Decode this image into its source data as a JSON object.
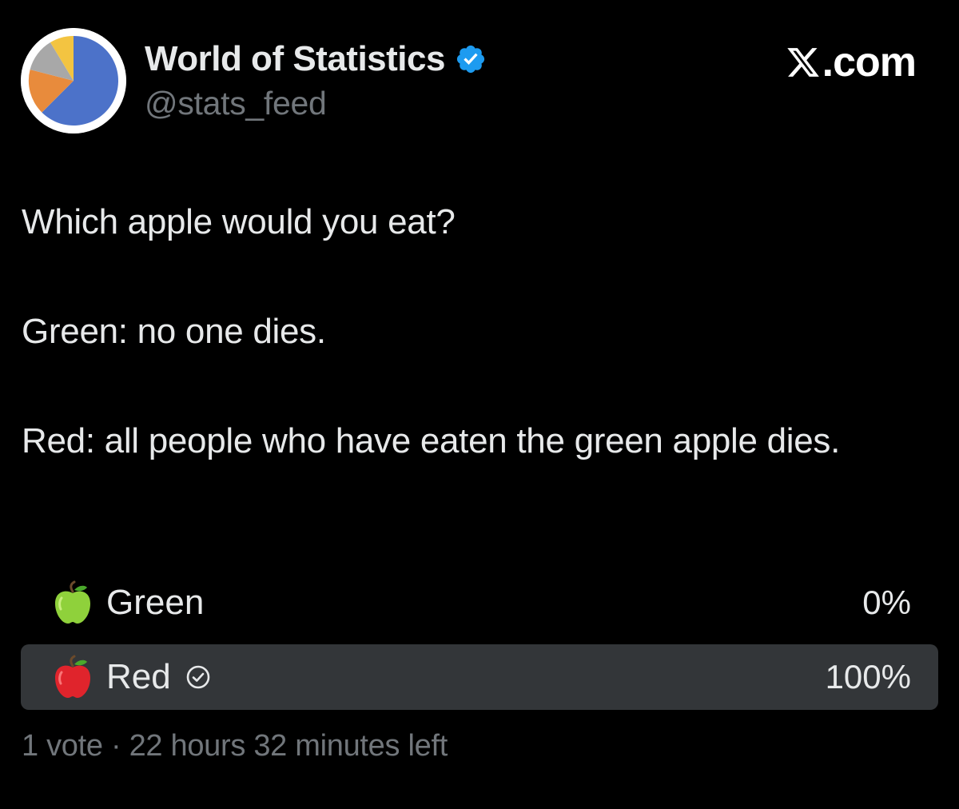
{
  "author": {
    "display_name": "World of Statistics",
    "handle": "@stats_feed",
    "avatar_icon": "pie-chart-avatar",
    "verified_icon": "verified-badge-icon",
    "verified_color": "#1d9bf0"
  },
  "brand": {
    "text": ".com",
    "icon": "x-logo-icon"
  },
  "tweet": {
    "paragraphs": [
      "Which apple would you eat?",
      "Green: no one dies.",
      "Red: all people who have eaten the green apple dies."
    ]
  },
  "poll": {
    "options": [
      {
        "emoji_icon": "green-apple-icon",
        "label": "Green",
        "percent_label": "0%",
        "fraction": 0,
        "selected": false
      },
      {
        "emoji_icon": "red-apple-icon",
        "label": "Red",
        "percent_label": "100%",
        "fraction": 1,
        "selected": true,
        "selected_icon": "check-circle-icon"
      }
    ],
    "meta": "1 vote · 22 hours 32 minutes left"
  },
  "colors": {
    "background": "#000000",
    "primary_text": "#e7e9ea",
    "secondary_text": "#71767b",
    "poll_fill": "#333639",
    "avatar_blue": "#4c72c9",
    "avatar_orange": "#e88b3c",
    "avatar_gray": "#a8a8a8",
    "avatar_yellow": "#f3c441"
  }
}
